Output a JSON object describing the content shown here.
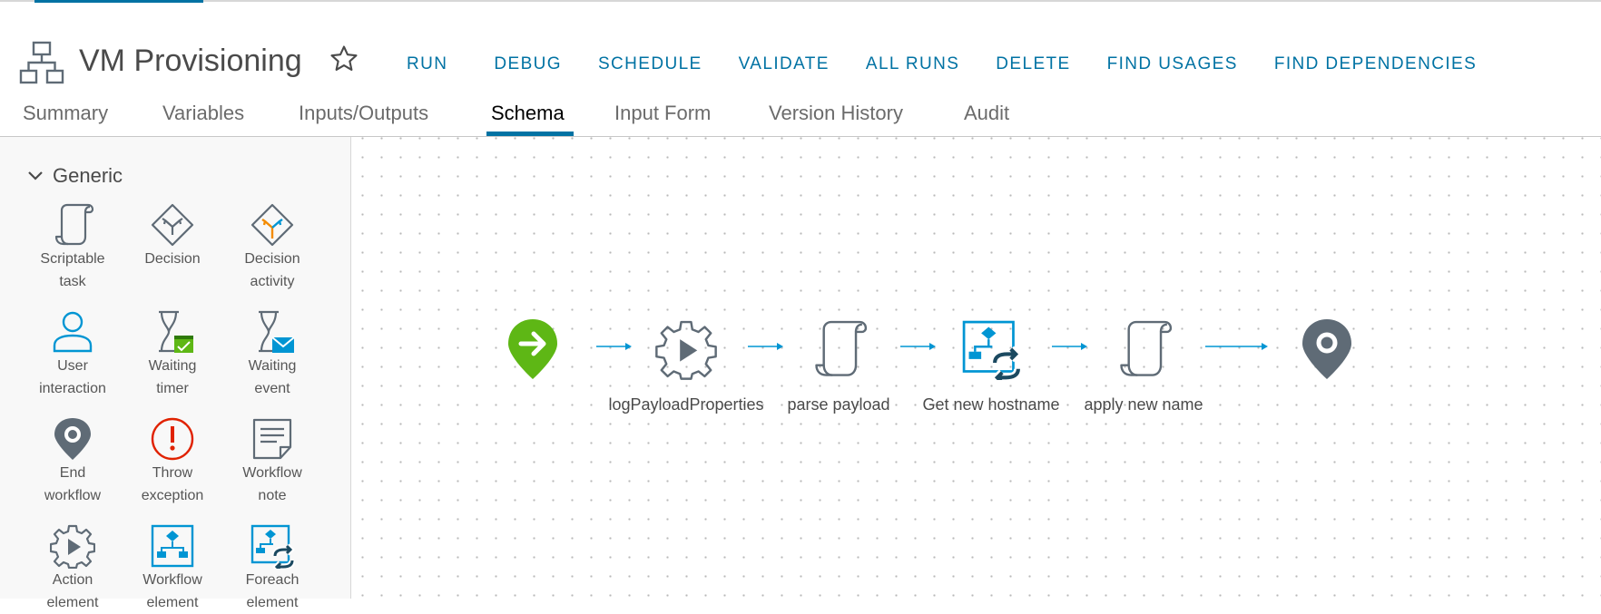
{
  "header": {
    "title": "VM Provisioning",
    "actions": [
      "RUN",
      "DEBUG",
      "SCHEDULE",
      "VALIDATE",
      "ALL RUNS",
      "DELETE",
      "FIND USAGES",
      "FIND DEPENDENCIES"
    ]
  },
  "tabs": [
    "Summary",
    "Variables",
    "Inputs/Outputs",
    "Schema",
    "Input Form",
    "Version History",
    "Audit"
  ],
  "active_tab": "Schema",
  "palette": {
    "group": "Generic",
    "items": [
      {
        "label1": "Scriptable",
        "label2": "task",
        "icon": "scriptable-task-icon"
      },
      {
        "label1": "Decision",
        "label2": "",
        "icon": "decision-icon"
      },
      {
        "label1": "Decision",
        "label2": "activity",
        "icon": "decision-activity-icon"
      },
      {
        "label1": "User",
        "label2": "interaction",
        "icon": "user-interaction-icon"
      },
      {
        "label1": "Waiting",
        "label2": "timer",
        "icon": "waiting-timer-icon"
      },
      {
        "label1": "Waiting",
        "label2": "event",
        "icon": "waiting-event-icon"
      },
      {
        "label1": "End",
        "label2": "workflow",
        "icon": "end-workflow-icon"
      },
      {
        "label1": "Throw",
        "label2": "exception",
        "icon": "throw-exception-icon"
      },
      {
        "label1": "Workflow",
        "label2": "note",
        "icon": "workflow-note-icon"
      },
      {
        "label1": "Action",
        "label2": "element",
        "icon": "action-element-icon"
      },
      {
        "label1": "Workflow",
        "label2": "element",
        "icon": "workflow-element-icon"
      },
      {
        "label1": "Foreach",
        "label2": "element",
        "icon": "foreach-element-icon"
      }
    ]
  },
  "schema": {
    "nodes": [
      {
        "label": "",
        "icon": "start-icon"
      },
      {
        "label": "logPayloadProperties",
        "icon": "action-element-icon"
      },
      {
        "label": "parse payload",
        "icon": "scriptable-task-icon"
      },
      {
        "label": "Get new hostname",
        "icon": "foreach-element-icon"
      },
      {
        "label": "apply new name",
        "icon": "scriptable-task-icon"
      },
      {
        "label": "",
        "icon": "end-workflow-icon"
      }
    ]
  },
  "colors": {
    "accent": "#0072a3",
    "start": "#5eb715",
    "end": "#5f6b76",
    "error": "#e02200",
    "icon_stroke": "#5f6b76",
    "icon_blue": "#0095d3"
  }
}
